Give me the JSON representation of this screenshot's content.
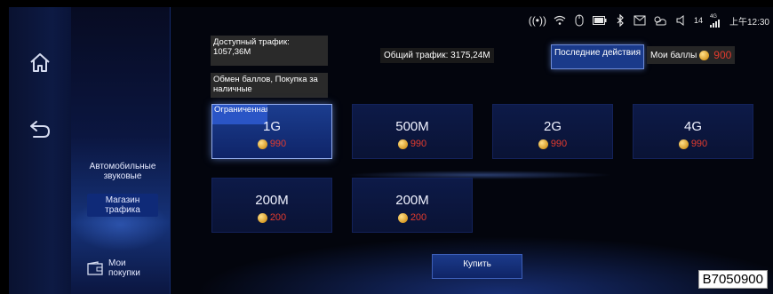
{
  "statusbar": {
    "signal_text": "4G",
    "battery_level": "14",
    "time": "上午12:30",
    "icons": [
      "hotspot-icon",
      "wifi-icon",
      "mouse-icon",
      "battery-icon",
      "bluetooth-icon",
      "message-icon",
      "weather-icon",
      "volume-icon",
      "cell-signal-icon"
    ]
  },
  "nav": {
    "icons": [
      "home-icon",
      "back-icon"
    ]
  },
  "sidebar": {
    "items": [
      {
        "label": "Автомобильные звуковые"
      },
      {
        "label": "Магазин трафика"
      }
    ],
    "purchases_label": "Мои покупки"
  },
  "info": {
    "available_traffic": "Доступный трафик: 1057,36M",
    "exchange_points": "Обмен баллов, Покупка за наличные",
    "total_traffic": "Общий трафик: 3175,24M",
    "recent_actions": "Последние действия",
    "my_points_label": "Мои баллы",
    "my_points_value": "900"
  },
  "cards": [
    {
      "size": "1G",
      "price": "990",
      "tag": "Ограниченная",
      "selected": true
    },
    {
      "size": "500M",
      "price": "990"
    },
    {
      "size": "2G",
      "price": "990"
    },
    {
      "size": "4G",
      "price": "990"
    },
    {
      "size": "200M",
      "price": "200"
    },
    {
      "size": "200M",
      "price": "200"
    }
  ],
  "buy_label": "Купить",
  "code_label": "B7050900",
  "colors": {
    "accent_blue": "#1b3a8a",
    "price_red": "#e23b2e",
    "coin_gold": "#d79b26"
  }
}
